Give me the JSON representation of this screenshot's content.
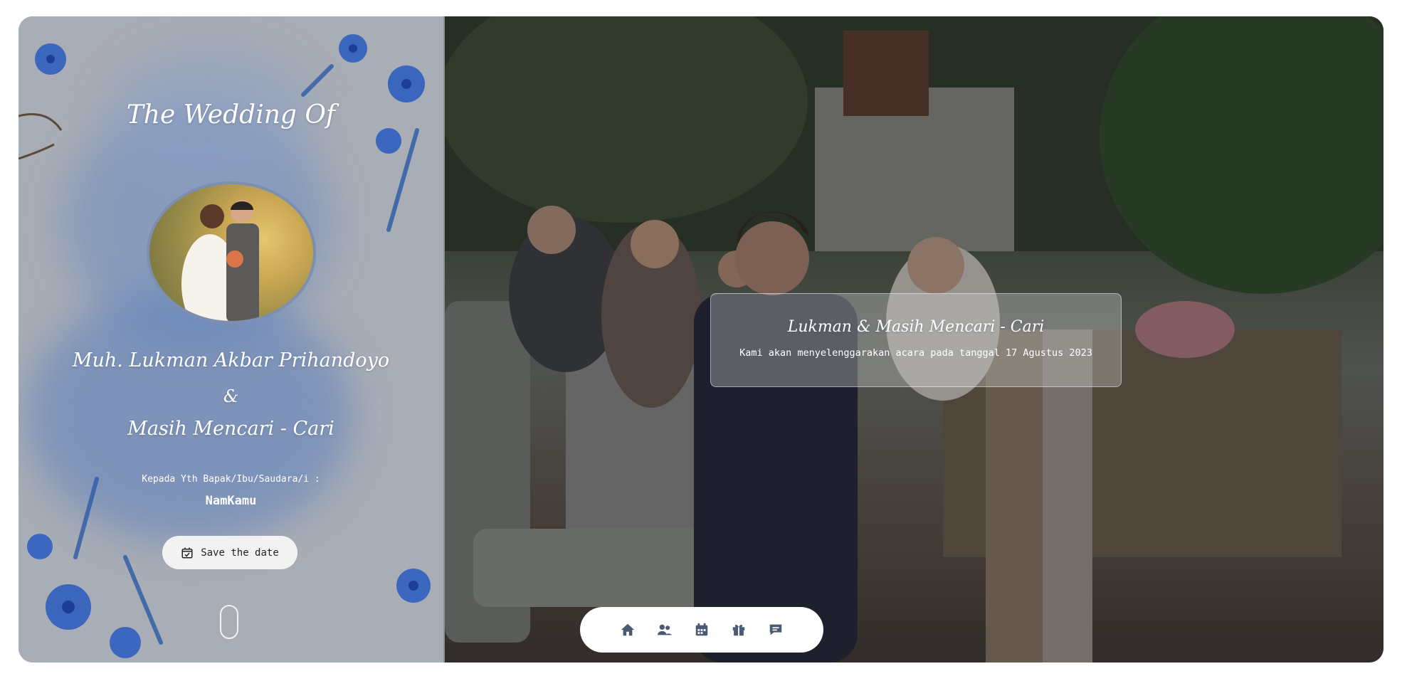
{
  "cover": {
    "title": "The Wedding Of",
    "groom": "Muh. Lukman Akbar Prihandoyo",
    "ampersand": "&",
    "bride": "Masih Mencari - Cari",
    "greeting": "Kepada Yth Bapak/Ibu/Saudara/i :",
    "guest_name": "NamKamu",
    "save_button": "Save the date",
    "save_icon": "calendar-check-icon"
  },
  "hero": {
    "card_title": "Lukman & Masih Mencari - Cari",
    "card_text": "Kami akan menyelenggarakan acara pada tanggal 17 Agustus 2023"
  },
  "nav": {
    "items": [
      {
        "icon": "home-icon"
      },
      {
        "icon": "users-icon"
      },
      {
        "icon": "calendar-icon"
      },
      {
        "icon": "gift-icon"
      },
      {
        "icon": "chat-icon"
      }
    ]
  },
  "colors": {
    "accent": "#4a5a73",
    "panel": "#a9adb5",
    "flower": "#2f5fbf"
  }
}
